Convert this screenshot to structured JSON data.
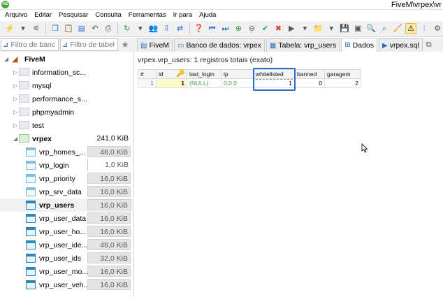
{
  "window": {
    "title": "FiveM\\vrpex\\vr",
    "app_icon_text": "HS"
  },
  "menu": [
    "Arquivo",
    "Editar",
    "Pesquisar",
    "Consulta",
    "Ferramentas",
    "Ir para",
    "Ajuda"
  ],
  "filters": {
    "database_placeholder": "Filtro de banc",
    "table_placeholder": "Filtro de tabel"
  },
  "tabs": [
    {
      "label": "FiveM",
      "icon": "server-icon",
      "active": false
    },
    {
      "label": "Banco de dados: vrpex",
      "icon": "database-icon",
      "active": false
    },
    {
      "label": "Tabela: vrp_users",
      "icon": "table-icon",
      "active": false
    },
    {
      "label": "Dados",
      "icon": "grid-icon",
      "active": true
    },
    {
      "label": "vrpex.sql",
      "icon": "sql-file-icon",
      "active": false
    }
  ],
  "tree": {
    "server": "FiveM",
    "databases": [
      {
        "name": "information_sc..."
      },
      {
        "name": "mysql"
      },
      {
        "name": "performance_s..."
      },
      {
        "name": "phpmyadmin"
      },
      {
        "name": "test"
      }
    ],
    "active_db": {
      "name": "vrpex",
      "size": "241,0 KiB"
    },
    "tables": [
      {
        "name": "vrp_homes_...",
        "size": "48,0 KiB",
        "bar": true,
        "light": true
      },
      {
        "name": "vrp_login",
        "size": "1,0 KiB",
        "bar": false,
        "light": true
      },
      {
        "name": "vrp_priority",
        "size": "16,0 KiB",
        "bar": true,
        "light": true
      },
      {
        "name": "vrp_srv_data",
        "size": "16,0 KiB",
        "bar": true,
        "light": true
      },
      {
        "name": "vrp_users",
        "size": "16,0 KiB",
        "bar": true,
        "light": false,
        "selected": true
      },
      {
        "name": "vrp_user_data",
        "size": "16,0 KiB",
        "bar": true,
        "light": false
      },
      {
        "name": "vrp_user_ho...",
        "size": "16,0 KiB",
        "bar": true,
        "light": false
      },
      {
        "name": "vrp_user_ide...",
        "size": "48,0 KiB",
        "bar": true,
        "light": false
      },
      {
        "name": "vrp_user_ids",
        "size": "32,0 KiB",
        "bar": true,
        "light": false
      },
      {
        "name": "vrp_user_mo...",
        "size": "16,0 KiB",
        "bar": true,
        "light": false
      },
      {
        "name": "vrp_user_veh...",
        "size": "16,0 KiB",
        "bar": true,
        "light": false
      }
    ]
  },
  "content": {
    "header": "vrpex.vrp_users: 1 registros totais (exato)",
    "columns": [
      "#",
      "id",
      "last_login",
      "ip",
      "whitelisted",
      "banned",
      "garagem"
    ],
    "rows": [
      [
        "1",
        "1",
        "(NULL)",
        "0.0.0",
        "1",
        "0",
        "2"
      ]
    ]
  },
  "colors": {
    "highlight": "#1f6fd3",
    "null_text": "#3aa03a",
    "key_icon": "#e0a51a"
  }
}
